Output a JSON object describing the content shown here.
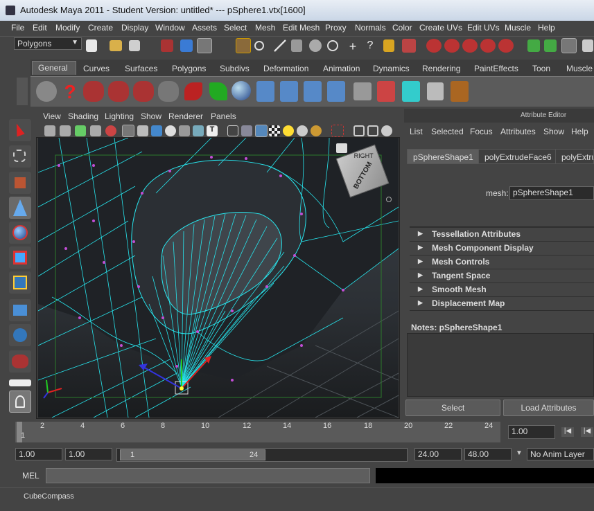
{
  "window": {
    "title": "Autodesk Maya 2011 - Student Version: untitled*   ---   pSphere1.vtx[1600]"
  },
  "menubar": [
    "File",
    "Edit",
    "Modify",
    "Create",
    "Display",
    "Window",
    "Assets",
    "Select",
    "Mesh",
    "Edit Mesh",
    "Proxy",
    "Normals",
    "Color",
    "Create UVs",
    "Edit UVs",
    "Muscle",
    "Help"
  ],
  "statusline": {
    "mode": "Polygons"
  },
  "shelf": {
    "tabs": [
      "General",
      "Curves",
      "Surfaces",
      "Polygons",
      "Subdivs",
      "Deformation",
      "Animation",
      "Dynamics",
      "Rendering",
      "PaintEffects",
      "Toon",
      "Muscle"
    ],
    "active": "General"
  },
  "panel": {
    "menus": [
      "View",
      "Shading",
      "Lighting",
      "Show",
      "Renderer",
      "Panels"
    ]
  },
  "viewcube": {
    "faces": [
      "RIGHT",
      "BOTTOM"
    ]
  },
  "attribute_editor": {
    "title": "Attribute Editor",
    "menus": [
      "List",
      "Selected",
      "Focus",
      "Attributes",
      "Show",
      "Help"
    ],
    "tabs": [
      "pSphereShape1",
      "polyExtrudeFace6",
      "polyExtru"
    ],
    "mesh_label": "mesh:",
    "mesh_value": "pSphereShape1",
    "sections": [
      "Tessellation Attributes",
      "Mesh Component Display",
      "Mesh Controls",
      "Tangent Space",
      "Smooth Mesh",
      "Displacement Map"
    ],
    "notes_label": "Notes:  pSphereShape1",
    "select_button": "Select",
    "load_button": "Load Attributes"
  },
  "timeslider": {
    "ticks": [
      "2",
      "4",
      "6",
      "8",
      "10",
      "12",
      "14",
      "16",
      "18",
      "20",
      "22",
      "24"
    ],
    "current": "1",
    "current_frame_field": "1.00"
  },
  "rangeslider": {
    "start": "1.00",
    "start2": "1.00",
    "range_start": "1",
    "range_end": "24",
    "end": "24.00",
    "end2": "48.00",
    "anim_layer": "No Anim Layer"
  },
  "commandline": {
    "label": "MEL"
  },
  "helpline": {
    "text": "CubeCompass"
  }
}
